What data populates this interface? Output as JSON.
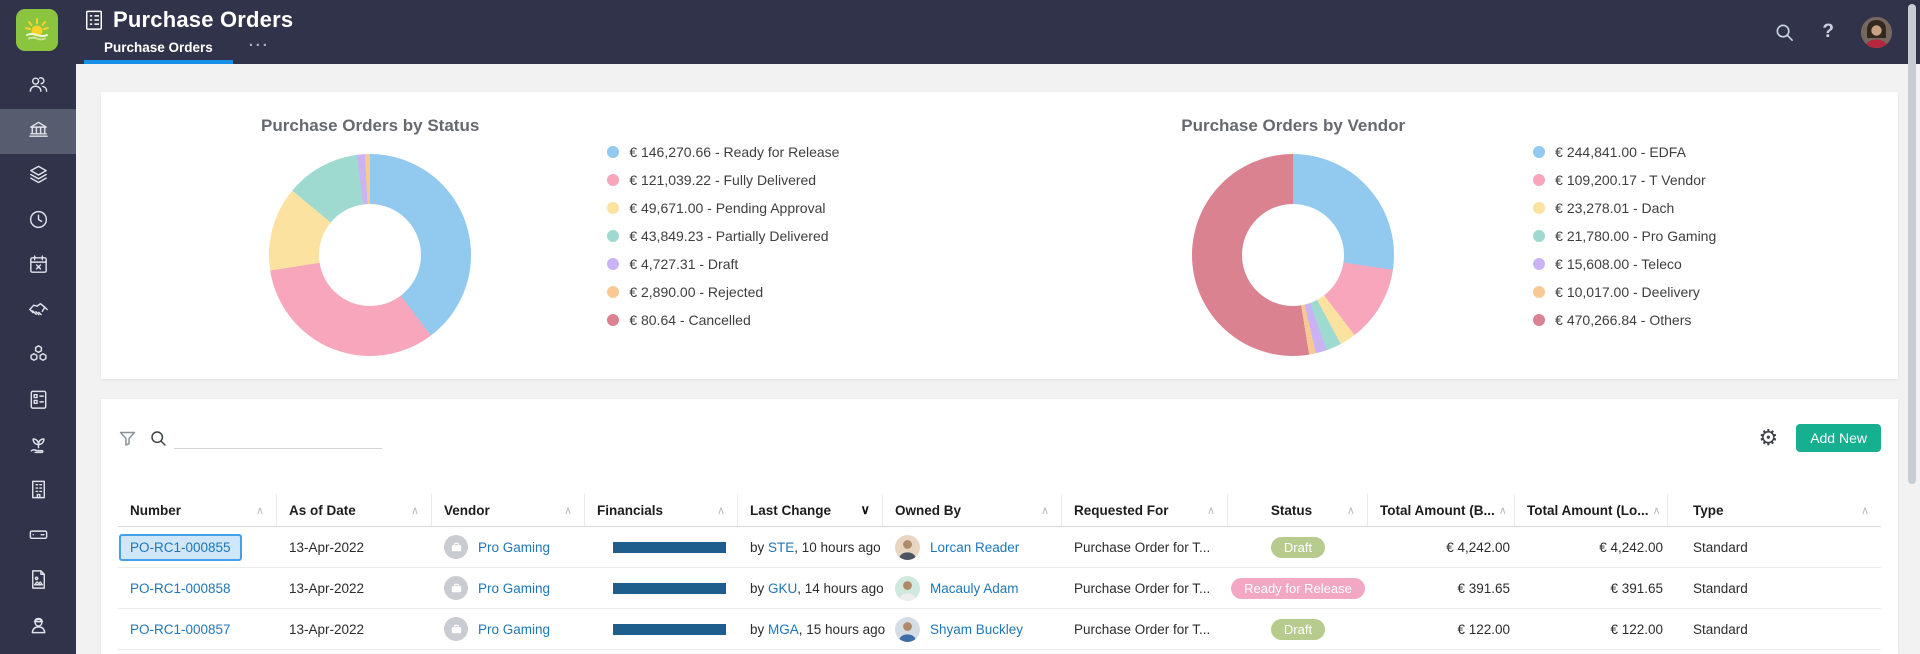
{
  "app": {
    "title": "Purchase Orders",
    "tab": "Purchase Orders",
    "more_tabs": "···"
  },
  "sidebar": {
    "items": [
      {
        "name": "users",
        "active": false
      },
      {
        "name": "purchasing",
        "active": true
      },
      {
        "name": "layers",
        "active": false
      },
      {
        "name": "time",
        "active": false
      },
      {
        "name": "calendar",
        "active": false
      },
      {
        "name": "partners",
        "active": false
      },
      {
        "name": "products",
        "active": false
      },
      {
        "name": "tasks",
        "active": false
      },
      {
        "name": "sustainability",
        "active": false
      },
      {
        "name": "company",
        "active": false
      },
      {
        "name": "storage",
        "active": false
      },
      {
        "name": "documents",
        "active": false
      },
      {
        "name": "personnel",
        "active": false
      }
    ]
  },
  "chart_data": [
    {
      "type": "donut",
      "title": "Purchase Orders by Status",
      "legend_position": "right",
      "items": [
        {
          "label": "Ready for Release",
          "value": 146270.66,
          "display": "€ 146,270.66",
          "color": "#92C9EF"
        },
        {
          "label": "Fully Delivered",
          "value": 121039.22,
          "display": "€ 121,039.22",
          "color": "#F7A6BB"
        },
        {
          "label": "Pending Approval",
          "value": 49671.0,
          "display": "€ 49,671.00",
          "color": "#FBE2A0"
        },
        {
          "label": "Partially Delivered",
          "value": 43849.23,
          "display": "€ 43,849.23",
          "color": "#9EDAD0"
        },
        {
          "label": "Draft",
          "value": 4727.31,
          "display": "€ 4,727.31",
          "color": "#C9B3F5"
        },
        {
          "label": "Rejected",
          "value": 2890.0,
          "display": "€ 2,890.00",
          "color": "#F9C995"
        },
        {
          "label": "Cancelled",
          "value": 80.64,
          "display": "€ 80.64",
          "color": "#DB8290"
        }
      ]
    },
    {
      "type": "donut",
      "title": "Purchase Orders by Vendor",
      "legend_position": "right",
      "items": [
        {
          "label": "EDFA",
          "value": 244841.0,
          "display": "€ 244,841.00",
          "color": "#92C9EF"
        },
        {
          "label": "T Vendor",
          "value": 109200.17,
          "display": "€ 109,200.17",
          "color": "#F7A6BB"
        },
        {
          "label": "Dach",
          "value": 23278.01,
          "display": "€ 23,278.01",
          "color": "#FBE2A0"
        },
        {
          "label": "Pro Gaming",
          "value": 21780.0,
          "display": "€ 21,780.00",
          "color": "#9EDAD0"
        },
        {
          "label": "Teleco",
          "value": 15608.0,
          "display": "€ 15,608.00",
          "color": "#C9B3F5"
        },
        {
          "label": "Deelivery",
          "value": 10017.0,
          "display": "€ 10,017.00",
          "color": "#F9C995"
        },
        {
          "label": "Others",
          "value": 470266.84,
          "display": "€ 470,266.84",
          "color": "#DB8290"
        }
      ]
    }
  ],
  "table": {
    "toolbar": {
      "add_new_label": "Add New",
      "search_value": ""
    },
    "by_label": "by ",
    "columns": [
      {
        "label": "Number",
        "sort": "none"
      },
      {
        "label": "As of Date",
        "sort": "none"
      },
      {
        "label": "Vendor",
        "sort": "none"
      },
      {
        "label": "Financials",
        "sort": "none"
      },
      {
        "label": "Last Change",
        "sort": "desc"
      },
      {
        "label": "Owned By",
        "sort": "none"
      },
      {
        "label": "Requested For",
        "sort": "none"
      },
      {
        "label": "Status",
        "sort": "none"
      },
      {
        "label": "Total Amount (B...",
        "sort": "none"
      },
      {
        "label": "Total Amount (Lo...",
        "sort": "none"
      },
      {
        "label": "Type",
        "sort": "none"
      }
    ],
    "rows": [
      {
        "number": "PO-RC1-000855",
        "selected": true,
        "as_of_date": "13-Apr-2022",
        "vendor": "Pro Gaming",
        "financials_pct": 100,
        "changed_user": "STE",
        "changed_suffix": ", 10 hours ago",
        "owned_by": "Lorcan Reader",
        "avatar": {
          "bg": "#E8D6C3",
          "shirt": "#4A5561"
        },
        "requested_for": "Purchase Order for T...",
        "status": {
          "label": "Draft",
          "bg": "#B6CB8D"
        },
        "total_base": "€ 4,242.00",
        "total_local": "€ 4,242.00",
        "type": "Standard"
      },
      {
        "number": "PO-RC1-000858",
        "selected": false,
        "as_of_date": "13-Apr-2022",
        "vendor": "Pro Gaming",
        "financials_pct": 100,
        "changed_user": "GKU",
        "changed_suffix": ", 14 hours ago",
        "owned_by": "Macauly Adam",
        "avatar": {
          "bg": "#CFE9DF",
          "shirt": "#EDEDED"
        },
        "requested_for": "Purchase Order for T...",
        "status": {
          "label": "Ready for Release",
          "bg": "#F2A7C2"
        },
        "total_base": "€ 391.65",
        "total_local": "€ 391.65",
        "type": "Standard"
      },
      {
        "number": "PO-RC1-000857",
        "selected": false,
        "as_of_date": "13-Apr-2022",
        "vendor": "Pro Gaming",
        "financials_pct": 100,
        "changed_user": "MGA",
        "changed_suffix": ", 15 hours ago",
        "owned_by": "Shyam Buckley",
        "avatar": {
          "bg": "#D5DDE4",
          "shirt": "#3E6EA8"
        },
        "requested_for": "Purchase Order for T...",
        "status": {
          "label": "Draft",
          "bg": "#B6CB8D"
        },
        "total_base": "€ 122.00",
        "total_local": "€ 122.00",
        "type": "Standard"
      }
    ]
  },
  "colors": {
    "accent_blue": "#1791E8",
    "brand_green": "#8BC53F",
    "button_teal": "#16AF90",
    "link_blue": "#1F76B8",
    "bar_blue": "#1D5E8D",
    "header_navy": "#303349",
    "selection_border": "#44A0E8",
    "selection_bg": "#CFE7F9",
    "status_draft": "#B6CB8D",
    "status_ready_for_release": "#F2A7C2"
  }
}
